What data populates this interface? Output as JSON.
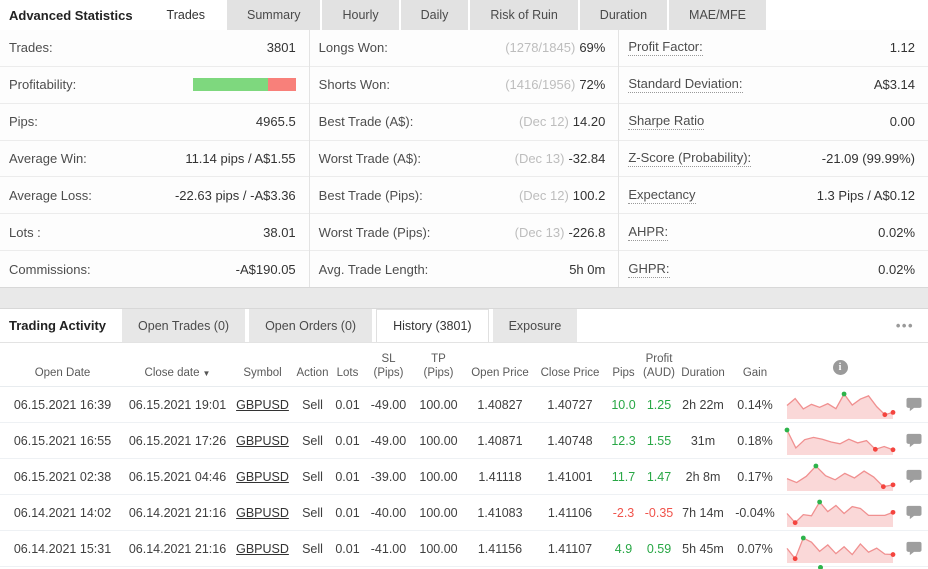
{
  "colors": {
    "green_text": "#28a745",
    "red_text": "#f0534b",
    "bar_green": "#7ed87e",
    "bar_red": "#f8807a",
    "spark_line": "#f09090",
    "spark_fill": "rgba(240,144,144,0.35)",
    "dot_green": "#2db34a",
    "dot_red": "#f4443e"
  },
  "stats_panel": {
    "title": "Advanced Statistics",
    "tabs": [
      {
        "label": "Trades",
        "active": true
      },
      {
        "label": "Summary"
      },
      {
        "label": "Hourly"
      },
      {
        "label": "Daily"
      },
      {
        "label": "Risk of Ruin"
      },
      {
        "label": "Duration"
      },
      {
        "label": "MAE/MFE"
      }
    ],
    "col1": [
      {
        "label": "Trades:",
        "value": "3801"
      },
      {
        "label": "Profitability:",
        "type": "bar",
        "green_pct": 73,
        "red_pct": 27
      },
      {
        "label": "Pips:",
        "value": "4965.5"
      },
      {
        "label": "Average Win:",
        "value": "11.14 pips / A$1.55"
      },
      {
        "label": "Average Loss:",
        "value": "-22.63 pips / -A$3.36"
      },
      {
        "label": "Lots :",
        "value": "38.01"
      },
      {
        "label": "Commissions:",
        "value": "-A$190.05"
      }
    ],
    "col2": [
      {
        "label": "Longs Won:",
        "muted": "(1278/1845)",
        "value": "69%"
      },
      {
        "label": "Shorts Won:",
        "muted": "(1416/1956)",
        "value": "72%"
      },
      {
        "label": "Best Trade (A$):",
        "muted": "(Dec 12)",
        "value": "14.20"
      },
      {
        "label": "Worst Trade (A$):",
        "muted": "(Dec 13)",
        "value": "-32.84"
      },
      {
        "label": "Best Trade (Pips):",
        "muted": "(Dec 12)",
        "value": "100.2"
      },
      {
        "label": "Worst Trade (Pips):",
        "muted": "(Dec 13)",
        "value": "-226.8"
      },
      {
        "label": "Avg. Trade Length:",
        "muted": "",
        "value": "5h 0m"
      }
    ],
    "col3": [
      {
        "label": "Profit Factor:",
        "value": "1.12"
      },
      {
        "label": "Standard Deviation:",
        "value": "A$3.14"
      },
      {
        "label": "Sharpe Ratio",
        "value": "0.00"
      },
      {
        "label": "Z-Score (Probability):",
        "value": "-21.09 (99.99%)"
      },
      {
        "label": "Expectancy",
        "value": "1.3 Pips / A$0.12"
      },
      {
        "label": "AHPR:",
        "value": "0.02%"
      },
      {
        "label": "GHPR:",
        "value": "0.02%"
      }
    ]
  },
  "activity_panel": {
    "title": "Trading Activity",
    "tabs": [
      {
        "label": "Open Trades (0)"
      },
      {
        "label": "Open Orders (0)"
      },
      {
        "label": "History (3801)",
        "active": true
      },
      {
        "label": "Exposure"
      }
    ],
    "menu": "•••"
  },
  "table": {
    "headers": [
      {
        "label": "Open Date"
      },
      {
        "label": "Close date",
        "sort_icon": "▼"
      },
      {
        "label": "Symbol"
      },
      {
        "label": "Action"
      },
      {
        "label": "Lots"
      },
      {
        "label": "SL",
        "sub": "(Pips)"
      },
      {
        "label": "TP",
        "sub": "(Pips)"
      },
      {
        "label": "Open Price"
      },
      {
        "label": "Close Price"
      },
      {
        "label": "Pips"
      },
      {
        "label": "Profit",
        "sub": "(AUD)"
      },
      {
        "label": "Duration"
      },
      {
        "label": "Gain"
      },
      {
        "label": "",
        "icon": "info-icon",
        "icon_text": "i"
      },
      {
        "label": ""
      }
    ],
    "rows": [
      {
        "open_date": "06.15.2021 16:39",
        "close_date": "06.15.2021 19:01",
        "symbol": "GBPUSD",
        "action": "Sell",
        "lots": "0.01",
        "sl": "-49.00",
        "tp": "100.00",
        "open_price": "1.40827",
        "close_price": "1.40727",
        "pips": "10.0",
        "profit": "1.25",
        "positive": true,
        "duration": "2h 22m",
        "gain": "0.14%",
        "spark": {
          "y": [
            0.5,
            0.8,
            0.35,
            0.55,
            0.42,
            0.58,
            0.36,
            1.0,
            0.52,
            0.78,
            0.92,
            0.45,
            0.1,
            0.2
          ],
          "green": [
            7
          ],
          "red": [
            12,
            13
          ]
        }
      },
      {
        "open_date": "06.15.2021 16:55",
        "close_date": "06.15.2021 17:26",
        "symbol": "GBPUSD",
        "action": "Sell",
        "lots": "0.01",
        "sl": "-49.00",
        "tp": "100.00",
        "open_price": "1.40871",
        "close_price": "1.40748",
        "pips": "12.3",
        "profit": "1.55",
        "positive": true,
        "duration": "31m",
        "gain": "0.18%",
        "spark": {
          "y": [
            1.0,
            0.22,
            0.58,
            0.68,
            0.6,
            0.48,
            0.4,
            0.6,
            0.44,
            0.54,
            0.16,
            0.28,
            0.14
          ],
          "green": [
            0
          ],
          "red": [
            10,
            12
          ]
        }
      },
      {
        "open_date": "06.15.2021 02:38",
        "close_date": "06.15.2021 04:46",
        "symbol": "GBPUSD",
        "action": "Sell",
        "lots": "0.01",
        "sl": "-39.00",
        "tp": "100.00",
        "open_price": "1.41118",
        "close_price": "1.41001",
        "pips": "11.7",
        "profit": "1.47",
        "positive": true,
        "duration": "2h 8m",
        "gain": "0.17%",
        "spark": {
          "y": [
            0.45,
            0.28,
            0.55,
            1.0,
            0.58,
            0.4,
            0.68,
            0.48,
            0.78,
            0.52,
            0.1,
            0.18
          ],
          "green": [
            3
          ],
          "red": [
            10,
            11
          ]
        }
      },
      {
        "open_date": "06.14.2021 14:02",
        "close_date": "06.14.2021 21:16",
        "symbol": "GBPUSD",
        "action": "Sell",
        "lots": "0.01",
        "sl": "-40.00",
        "tp": "100.00",
        "open_price": "1.41083",
        "close_price": "1.41106",
        "pips": "-2.3",
        "profit": "-0.35",
        "positive": false,
        "duration": "7h 14m",
        "gain": "-0.04%",
        "spark": {
          "y": [
            0.5,
            0.1,
            0.45,
            0.4,
            1.0,
            0.58,
            0.85,
            0.5,
            0.8,
            0.72,
            0.42,
            0.42,
            0.42,
            0.55
          ],
          "green": [
            4
          ],
          "red": [
            1,
            13
          ]
        }
      },
      {
        "open_date": "06.14.2021 15:31",
        "close_date": "06.14.2021 21:16",
        "symbol": "GBPUSD",
        "action": "Sell",
        "lots": "0.01",
        "sl": "-41.00",
        "tp": "100.00",
        "open_price": "1.41156",
        "close_price": "1.41107",
        "pips": "4.9",
        "profit": "0.59",
        "positive": true,
        "duration": "5h 45m",
        "gain": "0.07%",
        "spark": {
          "y": [
            0.55,
            0.1,
            1.0,
            0.82,
            0.42,
            0.7,
            0.32,
            0.62,
            0.28,
            0.74,
            0.38,
            0.56,
            0.3,
            0.28
          ],
          "green": [
            2
          ],
          "red": [
            1,
            13
          ]
        }
      }
    ]
  }
}
